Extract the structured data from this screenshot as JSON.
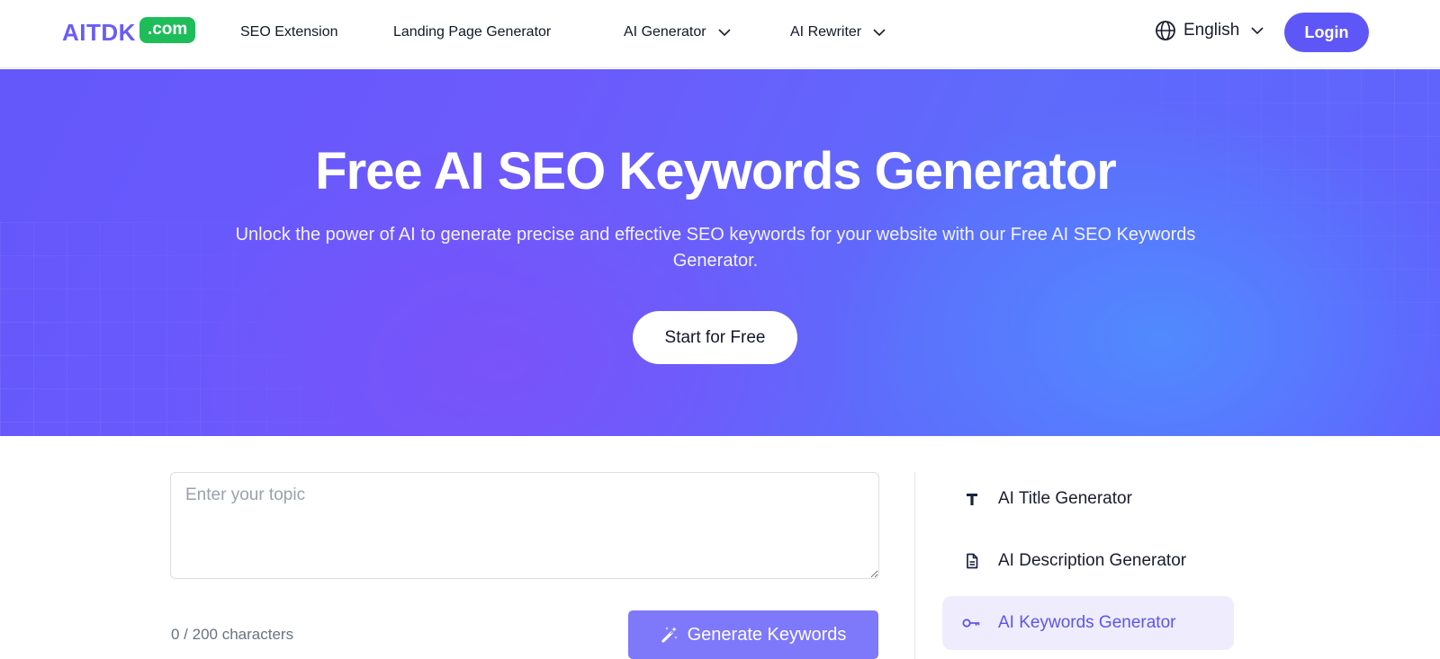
{
  "header": {
    "logo": {
      "text": "AITDK",
      "badge": ".com"
    },
    "nav": [
      {
        "label": "SEO Extension",
        "has_dropdown": false
      },
      {
        "label": "Landing Page Generator",
        "has_dropdown": false
      },
      {
        "label": "AI Generator",
        "has_dropdown": true
      },
      {
        "label": "AI Rewriter",
        "has_dropdown": true
      }
    ],
    "language": {
      "icon": "globe-icon",
      "label": "English"
    },
    "login_label": "Login"
  },
  "hero": {
    "title": "Free AI SEO Keywords Generator",
    "subtitle": "Unlock the power of AI to generate precise and effective SEO keywords for your website with our Free AI SEO Keywords Generator.",
    "cta_label": "Start for Free"
  },
  "tool": {
    "topic_input": {
      "value": "",
      "placeholder": "Enter your topic"
    },
    "char_count": "0 / 200 characters",
    "generate_label": "Generate Keywords",
    "generate_icon": "magic-wand-icon"
  },
  "sidebar": {
    "items": [
      {
        "label": "AI Title Generator",
        "icon": "title-icon",
        "active": false
      },
      {
        "label": "AI Description Generator",
        "icon": "document-icon",
        "active": false
      },
      {
        "label": "AI Keywords Generator",
        "icon": "key-icon",
        "active": true
      }
    ]
  },
  "colors": {
    "brand": "#5f56f7",
    "logo_badge": "#1ebd5a",
    "generate_button": "#7e78fb",
    "active_item_bg": "#efedfd",
    "active_item_text": "#5b55f0"
  }
}
